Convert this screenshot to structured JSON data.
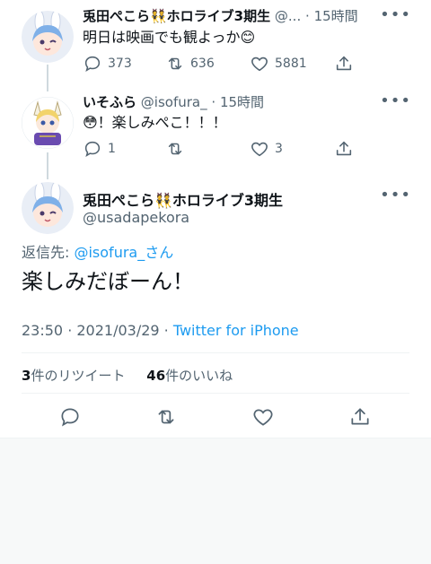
{
  "thread": [
    {
      "display_name": "兎田ぺこら👯ホロライブ3期生",
      "handle": "@...",
      "separator": "·",
      "time": "15時間",
      "more_icon": "more-icon",
      "text": "明日は映画でも観よっか😊",
      "actions": {
        "replies": "373",
        "retweets": "636",
        "likes": "5881"
      }
    },
    {
      "display_name": "いそふら",
      "handle": "@isofura_",
      "separator": "·",
      "time": "15時間",
      "more_icon": "more-icon",
      "text": "😳！楽しみぺこ！！！",
      "actions": {
        "replies": "1",
        "retweets": "",
        "likes": "3"
      }
    }
  ],
  "main_tweet": {
    "display_name": "兎田ぺこら👯ホロライブ3期生",
    "handle": "@usadapekora",
    "reply_prefix": "返信先: ",
    "reply_to": "@isofura_さん",
    "text": "楽しみだぼーん！",
    "time": "23:50 · 2021/03/29 · ",
    "source": "Twitter for iPhone",
    "retweet_count": "3",
    "retweet_label": "件のリツイート",
    "like_count": "46",
    "like_label": "件のいいね"
  },
  "colors": {
    "accent": "#1d9bf0",
    "text": "#0f1419",
    "muted": "#536471",
    "divider": "#eff3f4"
  }
}
